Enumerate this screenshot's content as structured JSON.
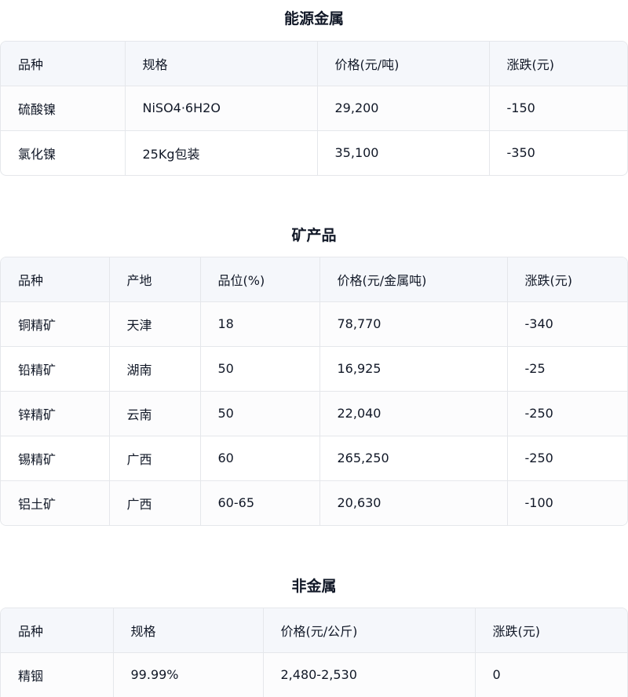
{
  "sections": [
    {
      "title": "能源金属",
      "headers": [
        "品种",
        "规格",
        "价格(元/吨)",
        "涨跌(元)"
      ],
      "rows": [
        [
          "硫酸镍",
          "NiSO4·6H2O",
          "29,200",
          "-150"
        ],
        [
          "氯化镍",
          "25Kg包装",
          "35,100",
          "-350"
        ]
      ]
    },
    {
      "title": "矿产品",
      "headers": [
        "品种",
        "产地",
        "品位(%)",
        "价格(元/金属吨)",
        "涨跌(元)"
      ],
      "rows": [
        [
          "铜精矿",
          "天津",
          "18",
          "78,770",
          "-340"
        ],
        [
          "铅精矿",
          "湖南",
          "50",
          "16,925",
          "-25"
        ],
        [
          "锌精矿",
          "云南",
          "50",
          "22,040",
          "-250"
        ],
        [
          "锡精矿",
          "广西",
          "60",
          "265,250",
          "-250"
        ],
        [
          "铝土矿",
          "广西",
          "60-65",
          "20,630",
          "-100"
        ]
      ]
    },
    {
      "title": "非金属",
      "headers": [
        "品种",
        "规格",
        "价格(元/公斤)",
        "涨跌(元)"
      ],
      "rows": [
        [
          "精铟",
          "99.99%",
          "2,480-2,530",
          "0"
        ]
      ]
    }
  ]
}
